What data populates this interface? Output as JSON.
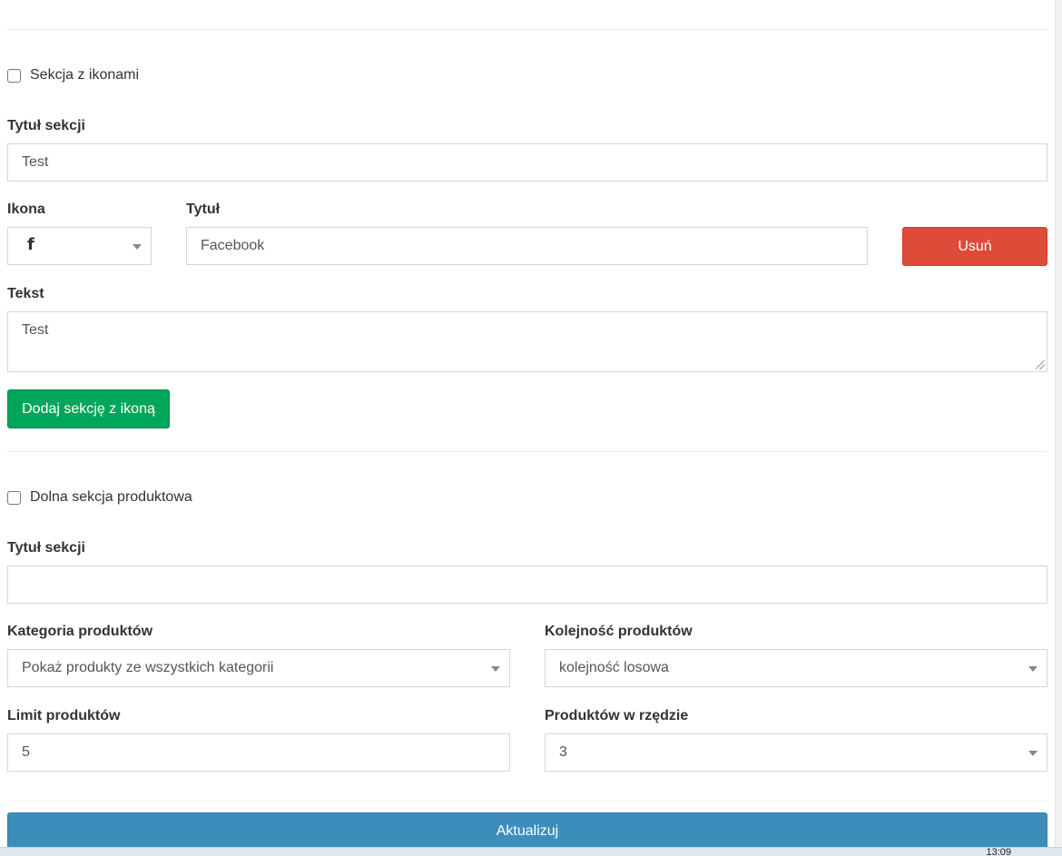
{
  "section_icons": {
    "checkbox_label": "Sekcja z ikonami",
    "title_label": "Tytuł sekcji",
    "title_value": "Test",
    "icon_label": "Ikona",
    "icon_glyph": "f",
    "icon_name": "facebook-icon",
    "item_title_label": "Tytuł",
    "item_title_value": "Facebook",
    "remove_label": "Usuń",
    "text_label": "Tekst",
    "text_value": "Test",
    "add_label": "Dodaj sekcję z ikoną"
  },
  "section_products": {
    "checkbox_label": "Dolna sekcja produktowa",
    "title_label": "Tytuł sekcji",
    "title_value": "",
    "category_label": "Kategoria produktów",
    "category_value": "Pokaż produkty ze wszystkich kategorii",
    "order_label": "Kolejność produktów",
    "order_value": "kolejność losowa",
    "limit_label": "Limit produktów",
    "limit_value": "5",
    "per_row_label": "Produktów w rzędzie",
    "per_row_value": "3"
  },
  "update_label": "Aktualizuj",
  "taskbar": {
    "clock": "13:09"
  },
  "colors": {
    "danger": "#dd4b39",
    "success": "#00a65a",
    "primary": "#3c8dbc"
  }
}
